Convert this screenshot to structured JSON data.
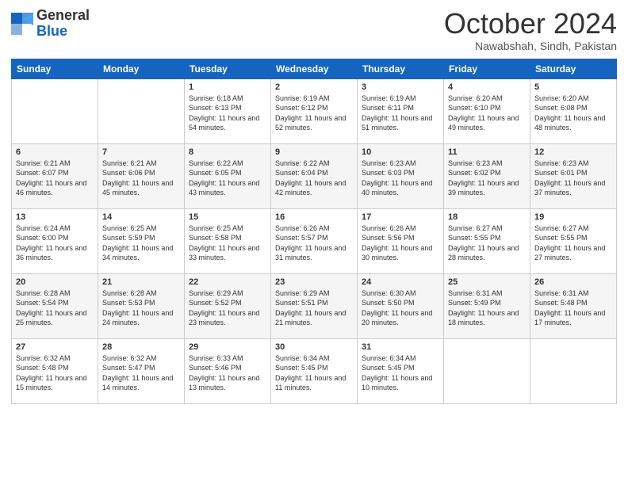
{
  "header": {
    "logo_general": "General",
    "logo_blue": "Blue",
    "month_title": "October 2024",
    "subtitle": "Nawabshah, Sindh, Pakistan"
  },
  "weekdays": [
    "Sunday",
    "Monday",
    "Tuesday",
    "Wednesday",
    "Thursday",
    "Friday",
    "Saturday"
  ],
  "weeks": [
    [
      {
        "day": "",
        "sunrise": "",
        "sunset": "",
        "daylight": ""
      },
      {
        "day": "",
        "sunrise": "",
        "sunset": "",
        "daylight": ""
      },
      {
        "day": "1",
        "sunrise": "Sunrise: 6:18 AM",
        "sunset": "Sunset: 6:13 PM",
        "daylight": "Daylight: 11 hours and 54 minutes."
      },
      {
        "day": "2",
        "sunrise": "Sunrise: 6:19 AM",
        "sunset": "Sunset: 6:12 PM",
        "daylight": "Daylight: 11 hours and 52 minutes."
      },
      {
        "day": "3",
        "sunrise": "Sunrise: 6:19 AM",
        "sunset": "Sunset: 6:11 PM",
        "daylight": "Daylight: 11 hours and 51 minutes."
      },
      {
        "day": "4",
        "sunrise": "Sunrise: 6:20 AM",
        "sunset": "Sunset: 6:10 PM",
        "daylight": "Daylight: 11 hours and 49 minutes."
      },
      {
        "day": "5",
        "sunrise": "Sunrise: 6:20 AM",
        "sunset": "Sunset: 6:08 PM",
        "daylight": "Daylight: 11 hours and 48 minutes."
      }
    ],
    [
      {
        "day": "6",
        "sunrise": "Sunrise: 6:21 AM",
        "sunset": "Sunset: 6:07 PM",
        "daylight": "Daylight: 11 hours and 46 minutes."
      },
      {
        "day": "7",
        "sunrise": "Sunrise: 6:21 AM",
        "sunset": "Sunset: 6:06 PM",
        "daylight": "Daylight: 11 hours and 45 minutes."
      },
      {
        "day": "8",
        "sunrise": "Sunrise: 6:22 AM",
        "sunset": "Sunset: 6:05 PM",
        "daylight": "Daylight: 11 hours and 43 minutes."
      },
      {
        "day": "9",
        "sunrise": "Sunrise: 6:22 AM",
        "sunset": "Sunset: 6:04 PM",
        "daylight": "Daylight: 11 hours and 42 minutes."
      },
      {
        "day": "10",
        "sunrise": "Sunrise: 6:23 AM",
        "sunset": "Sunset: 6:03 PM",
        "daylight": "Daylight: 11 hours and 40 minutes."
      },
      {
        "day": "11",
        "sunrise": "Sunrise: 6:23 AM",
        "sunset": "Sunset: 6:02 PM",
        "daylight": "Daylight: 11 hours and 39 minutes."
      },
      {
        "day": "12",
        "sunrise": "Sunrise: 6:23 AM",
        "sunset": "Sunset: 6:01 PM",
        "daylight": "Daylight: 11 hours and 37 minutes."
      }
    ],
    [
      {
        "day": "13",
        "sunrise": "Sunrise: 6:24 AM",
        "sunset": "Sunset: 6:00 PM",
        "daylight": "Daylight: 11 hours and 36 minutes."
      },
      {
        "day": "14",
        "sunrise": "Sunrise: 6:25 AM",
        "sunset": "Sunset: 5:59 PM",
        "daylight": "Daylight: 11 hours and 34 minutes."
      },
      {
        "day": "15",
        "sunrise": "Sunrise: 6:25 AM",
        "sunset": "Sunset: 5:58 PM",
        "daylight": "Daylight: 11 hours and 33 minutes."
      },
      {
        "day": "16",
        "sunrise": "Sunrise: 6:26 AM",
        "sunset": "Sunset: 5:57 PM",
        "daylight": "Daylight: 11 hours and 31 minutes."
      },
      {
        "day": "17",
        "sunrise": "Sunrise: 6:26 AM",
        "sunset": "Sunset: 5:56 PM",
        "daylight": "Daylight: 11 hours and 30 minutes."
      },
      {
        "day": "18",
        "sunrise": "Sunrise: 6:27 AM",
        "sunset": "Sunset: 5:55 PM",
        "daylight": "Daylight: 11 hours and 28 minutes."
      },
      {
        "day": "19",
        "sunrise": "Sunrise: 6:27 AM",
        "sunset": "Sunset: 5:55 PM",
        "daylight": "Daylight: 11 hours and 27 minutes."
      }
    ],
    [
      {
        "day": "20",
        "sunrise": "Sunrise: 6:28 AM",
        "sunset": "Sunset: 5:54 PM",
        "daylight": "Daylight: 11 hours and 25 minutes."
      },
      {
        "day": "21",
        "sunrise": "Sunrise: 6:28 AM",
        "sunset": "Sunset: 5:53 PM",
        "daylight": "Daylight: 11 hours and 24 minutes."
      },
      {
        "day": "22",
        "sunrise": "Sunrise: 6:29 AM",
        "sunset": "Sunset: 5:52 PM",
        "daylight": "Daylight: 11 hours and 23 minutes."
      },
      {
        "day": "23",
        "sunrise": "Sunrise: 6:29 AM",
        "sunset": "Sunset: 5:51 PM",
        "daylight": "Daylight: 11 hours and 21 minutes."
      },
      {
        "day": "24",
        "sunrise": "Sunrise: 6:30 AM",
        "sunset": "Sunset: 5:50 PM",
        "daylight": "Daylight: 11 hours and 20 minutes."
      },
      {
        "day": "25",
        "sunrise": "Sunrise: 6:31 AM",
        "sunset": "Sunset: 5:49 PM",
        "daylight": "Daylight: 11 hours and 18 minutes."
      },
      {
        "day": "26",
        "sunrise": "Sunrise: 6:31 AM",
        "sunset": "Sunset: 5:48 PM",
        "daylight": "Daylight: 11 hours and 17 minutes."
      }
    ],
    [
      {
        "day": "27",
        "sunrise": "Sunrise: 6:32 AM",
        "sunset": "Sunset: 5:48 PM",
        "daylight": "Daylight: 11 hours and 15 minutes."
      },
      {
        "day": "28",
        "sunrise": "Sunrise: 6:32 AM",
        "sunset": "Sunset: 5:47 PM",
        "daylight": "Daylight: 11 hours and 14 minutes."
      },
      {
        "day": "29",
        "sunrise": "Sunrise: 6:33 AM",
        "sunset": "Sunset: 5:46 PM",
        "daylight": "Daylight: 11 hours and 13 minutes."
      },
      {
        "day": "30",
        "sunrise": "Sunrise: 6:34 AM",
        "sunset": "Sunset: 5:45 PM",
        "daylight": "Daylight: 11 hours and 11 minutes."
      },
      {
        "day": "31",
        "sunrise": "Sunrise: 6:34 AM",
        "sunset": "Sunset: 5:45 PM",
        "daylight": "Daylight: 11 hours and 10 minutes."
      },
      {
        "day": "",
        "sunrise": "",
        "sunset": "",
        "daylight": ""
      },
      {
        "day": "",
        "sunrise": "",
        "sunset": "",
        "daylight": ""
      }
    ]
  ]
}
